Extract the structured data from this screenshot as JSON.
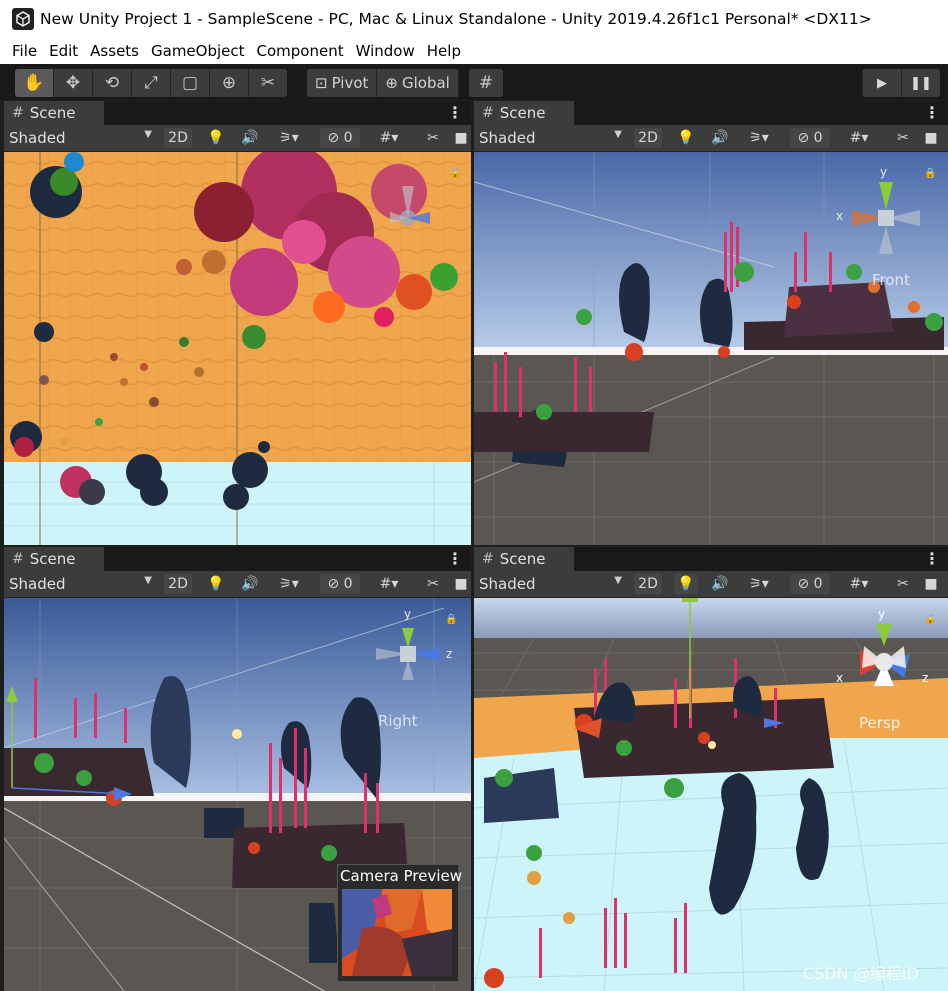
{
  "window": {
    "title": "New Unity Project 1 - SampleScene - PC, Mac & Linux Standalone - Unity 2019.4.26f1c1 Personal* <DX11>"
  },
  "menu": [
    "File",
    "Edit",
    "Assets",
    "GameObject",
    "Component",
    "Window",
    "Help"
  ],
  "toolbar": {
    "tools": [
      "hand-tool",
      "move-tool",
      "rotate-tool",
      "scale-tool",
      "rect-tool",
      "transform-tool",
      "custom-tool"
    ],
    "pivot_label": "Pivot",
    "global_label": "Global",
    "grid_snap": "grid-snap-icon",
    "play": "play-icon",
    "pause": "pause-icon"
  },
  "scene_panes": [
    {
      "tab": "Scene",
      "shading": "Shaded",
      "mode_2d": "2D",
      "hidden_count": "0",
      "view_label": ""
    },
    {
      "tab": "Scene",
      "shading": "Shaded",
      "mode_2d": "2D",
      "hidden_count": "0",
      "view_label": "Front"
    },
    {
      "tab": "Scene",
      "shading": "Shaded",
      "mode_2d": "2D",
      "hidden_count": "0",
      "view_label": "Right"
    },
    {
      "tab": "Scene",
      "shading": "Shaded",
      "mode_2d": "2D",
      "hidden_count": "0",
      "view_label": "Persp"
    }
  ],
  "gizmo": {
    "y": "y",
    "x": "x",
    "z": "z"
  },
  "camera_preview": {
    "title": "Camera Preview"
  },
  "watermark": "CSDN @编程ID",
  "colors": {
    "sand": "#f0a64c",
    "water": "#cdf4f8",
    "sky_top": "#5a78b8",
    "floor": "#5a5651",
    "coral_pink": "#e0306a",
    "rock": "#1e2a40"
  }
}
